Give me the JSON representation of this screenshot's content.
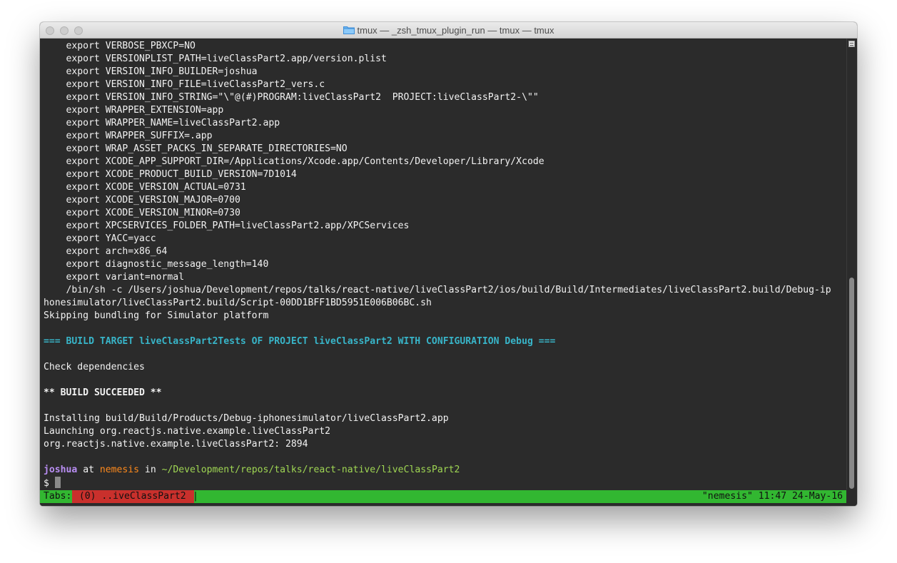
{
  "window": {
    "title": "tmux — _zsh_tmux_plugin_run — tmux — tmux"
  },
  "terminal": {
    "lines": [
      "    export VERBOSE_PBXCP=NO",
      "    export VERSIONPLIST_PATH=liveClassPart2.app/version.plist",
      "    export VERSION_INFO_BUILDER=joshua",
      "    export VERSION_INFO_FILE=liveClassPart2_vers.c",
      "    export VERSION_INFO_STRING=\"\\\"@(#)PROGRAM:liveClassPart2  PROJECT:liveClassPart2-\\\"\"",
      "    export WRAPPER_EXTENSION=app",
      "    export WRAPPER_NAME=liveClassPart2.app",
      "    export WRAPPER_SUFFIX=.app",
      "    export WRAP_ASSET_PACKS_IN_SEPARATE_DIRECTORIES=NO",
      "    export XCODE_APP_SUPPORT_DIR=/Applications/Xcode.app/Contents/Developer/Library/Xcode",
      "    export XCODE_PRODUCT_BUILD_VERSION=7D1014",
      "    export XCODE_VERSION_ACTUAL=0731",
      "    export XCODE_VERSION_MAJOR=0700",
      "    export XCODE_VERSION_MINOR=0730",
      "    export XPCSERVICES_FOLDER_PATH=liveClassPart2.app/XPCServices",
      "    export YACC=yacc",
      "    export arch=x86_64",
      "    export diagnostic_message_length=140",
      "    export variant=normal",
      "    /bin/sh -c /Users/joshua/Development/repos/talks/react-native/liveClassPart2/ios/build/Build/Intermediates/liveClassPart2.build/Debug-ip",
      "honesimulator/liveClassPart2.build/Script-00DD1BFF1BD5951E006B06BC.sh",
      "Skipping bundling for Simulator platform",
      "",
      "=== BUILD TARGET liveClassPart2Tests OF PROJECT liveClassPart2 WITH CONFIGURATION Debug ===",
      "",
      "Check dependencies",
      "",
      "** BUILD SUCCEEDED **",
      "",
      "Installing build/Build/Products/Debug-iphonesimulator/liveClassPart2.app",
      "Launching org.reactjs.native.example.liveClassPart2",
      "org.reactjs.native.example.liveClassPart2: 2894",
      ""
    ],
    "prompt": {
      "user": "joshua",
      "at": " at ",
      "host": "nemesis",
      "in": " in ",
      "path": "~/Development/repos/talks/react-native/liveClassPart2",
      "symbol": "$ "
    }
  },
  "statusbar": {
    "tabs_label": "Tabs:",
    "active_window": " (0) ..iveClassPart2 ",
    "separator": "|",
    "right": "\"nemesis\" 11:47 24-May-16"
  },
  "colors": {
    "background": "#2b2b2b",
    "header_cyan": "#38b5c9",
    "prompt_user": "#b98ef3",
    "prompt_host": "#ff8a1c",
    "prompt_path": "#9fd653",
    "statusbar_green": "#32b731",
    "statusbar_window_red": "#c9302c"
  },
  "icons": {
    "title_icon": "folder-icon"
  }
}
